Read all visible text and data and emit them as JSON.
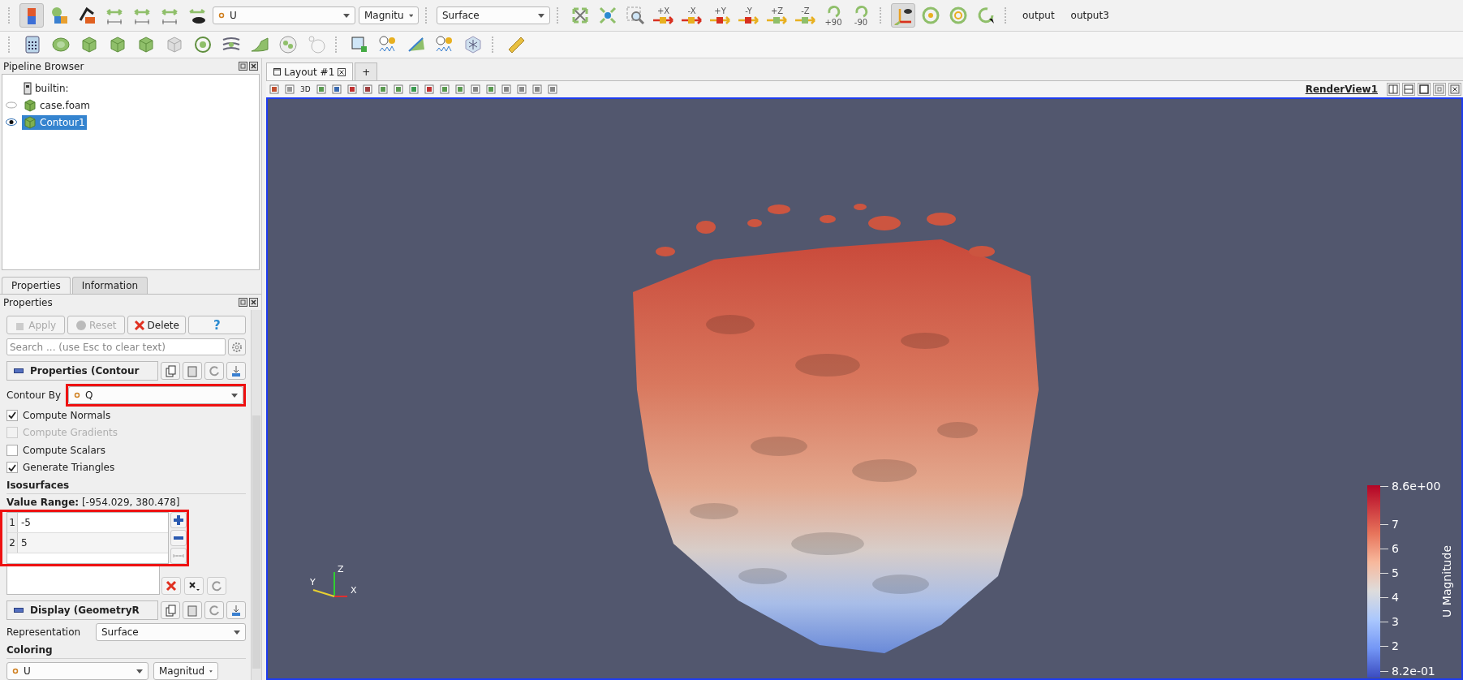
{
  "main_toolbar": {
    "array_combo": {
      "value": "U"
    },
    "component_combo": {
      "value": "Magnitu"
    },
    "representation_combo": {
      "value": "Surface"
    },
    "view_buttons": [
      {
        "label": "+X"
      },
      {
        "label": "-X"
      },
      {
        "label": "+Y"
      },
      {
        "label": "-Y"
      },
      {
        "label": "+Z"
      },
      {
        "label": "-Z"
      }
    ],
    "rotate_buttons": [
      {
        "label": "+90"
      },
      {
        "label": "-90"
      }
    ],
    "text_buttons": [
      "output",
      "output3"
    ]
  },
  "pipeline_browser": {
    "title": "Pipeline Browser",
    "items": [
      {
        "label": "builtin:",
        "kind": "server",
        "selected": false,
        "children": [
          {
            "label": "case.foam",
            "kind": "source",
            "visible": false,
            "selected": false,
            "children": [
              {
                "label": "Contour1",
                "kind": "source",
                "visible": true,
                "selected": true
              }
            ]
          }
        ]
      }
    ]
  },
  "panel_tabs": [
    {
      "label": "Properties",
      "selected": true
    },
    {
      "label": "Information",
      "selected": false
    }
  ],
  "properties": {
    "title": "Properties",
    "buttons": [
      {
        "label": "Apply",
        "kind": "apply",
        "disabled": true
      },
      {
        "label": "Reset",
        "kind": "reset",
        "disabled": true
      },
      {
        "label": "Delete",
        "kind": "delete",
        "disabled": false
      },
      {
        "label": "?",
        "kind": "help",
        "disabled": false
      }
    ],
    "search": {
      "placeholder": "Search ... (use Esc to clear text)"
    },
    "section": "Properties (Contour",
    "contour_by": {
      "label": "Contour By",
      "value": "Q",
      "highlighted": true
    },
    "options": [
      {
        "label": "Compute Normals",
        "checked": true,
        "disabled": false
      },
      {
        "label": "Compute Gradients",
        "checked": false,
        "disabled": true
      },
      {
        "label": "Compute Scalars",
        "checked": false,
        "disabled": false
      },
      {
        "label": "Generate Triangles",
        "checked": true,
        "disabled": false
      }
    ],
    "isosurfaces": {
      "heading": "Isosurfaces",
      "range": "**Value Range:** [-954.029, 380.478]",
      "highlighted": true,
      "rows": [
        {
          "index": "1",
          "value": "-5"
        },
        {
          "index": "2",
          "value": "5"
        }
      ]
    },
    "display_section": "Display (GeometryR",
    "representation": {
      "label": "Representation",
      "value": "Surface"
    },
    "coloring": {
      "heading": "Coloring",
      "array": "U",
      "component": "Magnitud"
    }
  },
  "layout_tabs": [
    {
      "label": "Layout #1",
      "kind": "layout",
      "selected": true
    },
    {
      "label": "+",
      "kind": "add",
      "selected": false
    }
  ],
  "view_toolbar": {
    "mode_label": "3D",
    "view_name": "RenderView1"
  },
  "render_view": {
    "axes": [
      {
        "label": "Z"
      },
      {
        "label": "Y"
      },
      {
        "label": "X"
      }
    ],
    "color_legend": {
      "title": "U Magnitude",
      "ticks": [
        "8.6e+00",
        "7",
        "6",
        "5",
        "4",
        "3",
        "2",
        "8.2e-01"
      ]
    }
  }
}
